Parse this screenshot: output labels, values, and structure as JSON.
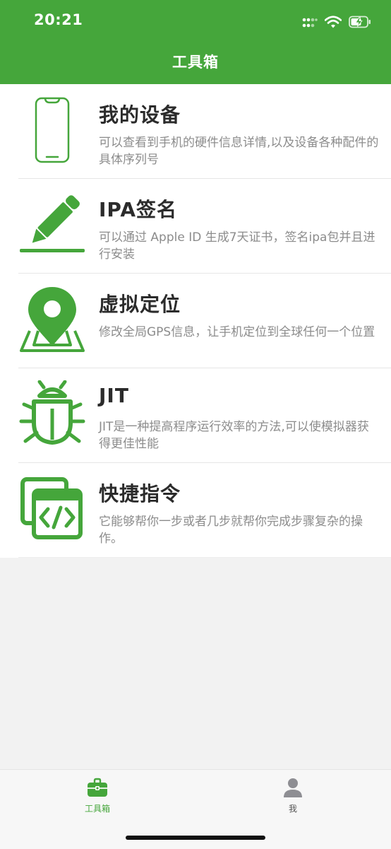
{
  "status_bar": {
    "time": "20:21"
  },
  "nav": {
    "title": "工具箱"
  },
  "items": [
    {
      "title": "我的设备",
      "desc": "可以查看到手机的硬件信息详情,以及设备各种配件的具体序列号",
      "icon": "phone-icon"
    },
    {
      "title": "IPA签名",
      "desc": "可以通过 Apple ID 生成7天证书，签名ipa包并且进行安装",
      "icon": "pencil-icon"
    },
    {
      "title": "虚拟定位",
      "desc": "修改全局GPS信息，让手机定位到全球任何一个位置",
      "icon": "map-pin-icon"
    },
    {
      "title": "JIT",
      "desc": "JIT是一种提高程序运行效率的方法,可以使模拟器获得更佳性能",
      "icon": "bug-icon"
    },
    {
      "title": "快捷指令",
      "desc": "它能够帮你一步或者几步就帮你完成步骤复杂的操作。",
      "icon": "code-window-icon"
    }
  ],
  "tabbar": {
    "tools_label": "工具箱",
    "me_label": "我"
  },
  "colors": {
    "accent": "#45a63b",
    "background": "#f2f2f2",
    "title_text": "#2b2b2b",
    "desc_text": "#8c8c8c"
  }
}
